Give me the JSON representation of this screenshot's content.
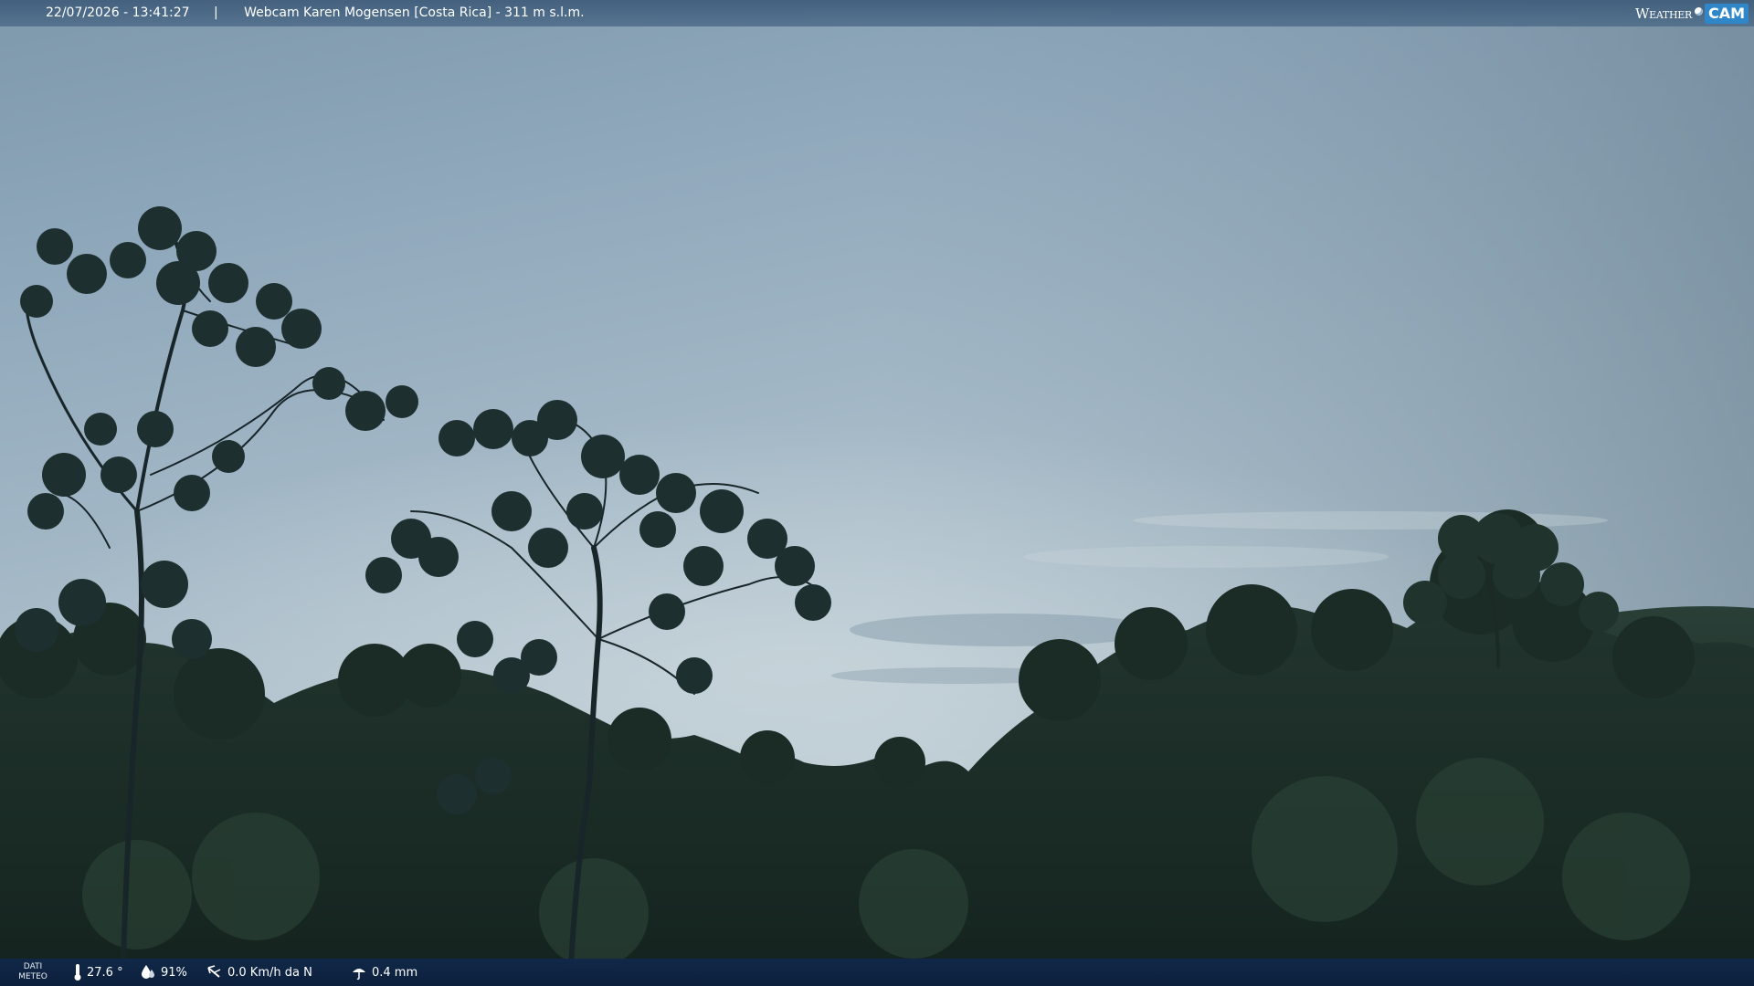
{
  "overlay_top": {
    "datetime": "22/07/2026 - 13:41:27",
    "separator": "|",
    "title": "Webcam Karen Mogensen [Costa Rica] - 311 m s.l.m."
  },
  "logo": {
    "weather": "Weather",
    "cam": "CAM"
  },
  "overlay_bottom": {
    "label_line1": "DATI",
    "label_line2": "METEO",
    "temperature": "27.6 °",
    "humidity": "91%",
    "wind": "0.0 Km/h da N",
    "rain": "0.4 mm"
  },
  "icons": {
    "temperature": "thermometer-icon",
    "humidity": "humidity-icon",
    "wind": "wind-icon",
    "rain": "rain-icon"
  },
  "colors": {
    "sky_top": "#8aa3b7",
    "sky_bottom": "#b3c5cf",
    "vegetation": "#1a2b26",
    "top_bar": "#4a6c8c",
    "bottom_bar": "#10284a",
    "logo_accent": "#2f86c9"
  }
}
